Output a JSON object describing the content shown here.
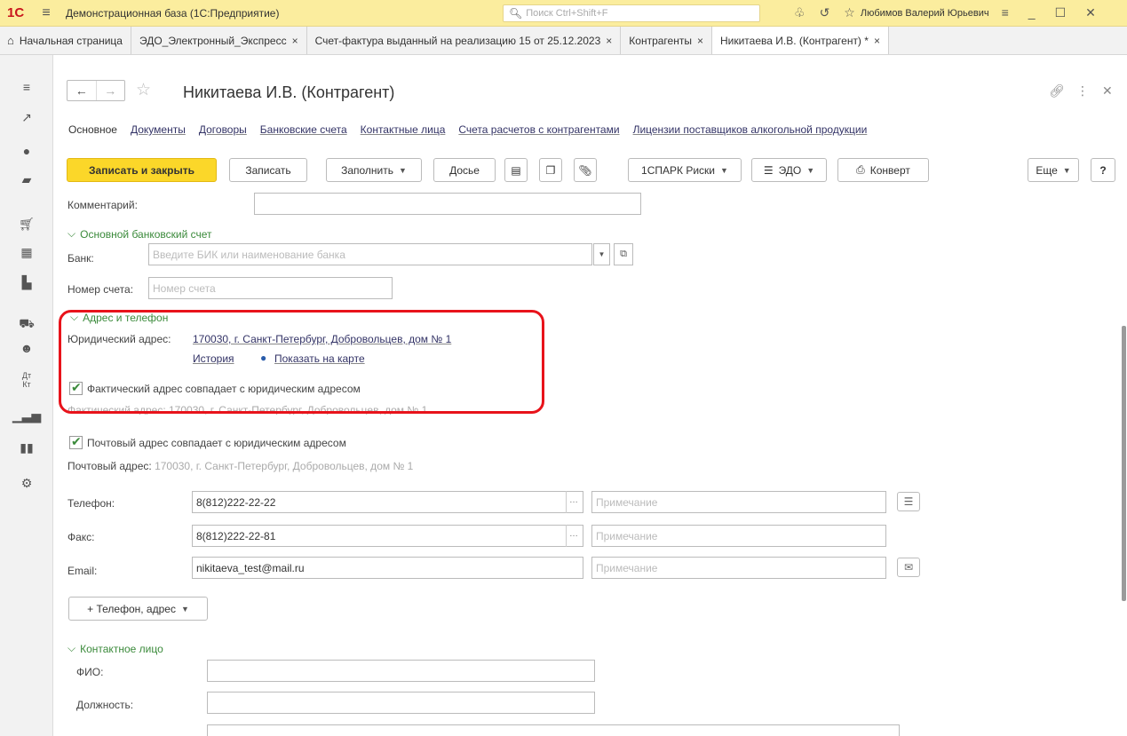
{
  "titlebar": {
    "logo": "1С",
    "app_title": "Демонстрационная база  (1С:Предприятие)",
    "search_placeholder": "Поиск Ctrl+Shift+F",
    "user": "Любимов Валерий Юрьевич"
  },
  "tabs": [
    {
      "label": "Начальная страница"
    },
    {
      "label": "ЭДО_Электронный_Экспресс",
      "close": "×"
    },
    {
      "label": "Счет-фактура выданный на реализацию 15 от 25.12.2023",
      "close": "×"
    },
    {
      "label": "Контрагенты",
      "close": "×"
    },
    {
      "label": "Никитаева И.В. (Контрагент) *",
      "close": "×"
    }
  ],
  "form": {
    "title": "Никитаева И.В. (Контрагент)",
    "nav": {
      "current": "Основное",
      "links": [
        "Документы",
        "Договоры",
        "Банковские счета",
        "Контактные лица",
        "Счета расчетов с контрагентами",
        "Лицензии поставщиков алкогольной продукции"
      ]
    },
    "toolbar": {
      "save_close": "Записать и закрыть",
      "save": "Записать",
      "fill": "Заполнить",
      "dossier": "Досье",
      "spark": "1СПАРК Риски",
      "edo": "ЭДО",
      "envelope": "Конверт",
      "more": "Еще",
      "help": "?"
    },
    "comment": {
      "label": "Комментарий:",
      "value": ""
    },
    "bank_section": {
      "header": "Основной банковский счет",
      "bank_label": "Банк:",
      "bank_placeholder": "Введите БИК или наименование банка",
      "account_label": "Номер счета:",
      "account_placeholder": "Номер счета"
    },
    "address_section": {
      "header": "Адрес и телефон",
      "legal_label": "Юридический адрес:",
      "legal_value": "170030, г. Санкт-Петербург, Добровольцев, дом № 1",
      "history": "История",
      "show_map": "Показать на карте",
      "actual_same": "Фактический адрес совпадает с юридическим адресом",
      "actual_label": "Фактический адрес:",
      "actual_value": "170030, г. Санкт-Петербург, Добровольцев, дом № 1",
      "postal_same": "Почтовый адрес совпадает с юридическим адресом",
      "postal_label": "Почтовый адрес:",
      "postal_value": "170030, г. Санкт-Петербург, Добровольцев, дом № 1"
    },
    "phone": {
      "label": "Телефон:",
      "value": "8(812)222-22-22",
      "note_placeholder": "Примечание"
    },
    "fax": {
      "label": "Факс:",
      "value": "8(812)222-22-81",
      "note_placeholder": "Примечание"
    },
    "email": {
      "label": "Email:",
      "value": "nikitaeva_test@mail.ru",
      "note_placeholder": "Примечание"
    },
    "add_contact_button": "+ Телефон, адрес",
    "contact_section": {
      "header": "Контактное лицо",
      "fio_label": "ФИО:",
      "position_label": "Должность:"
    }
  },
  "colors": {
    "accent_yellow": "#fbd729",
    "titlebar": "#fbed9e",
    "section_green": "#3b8a3b",
    "highlight_red": "#e8131b"
  }
}
